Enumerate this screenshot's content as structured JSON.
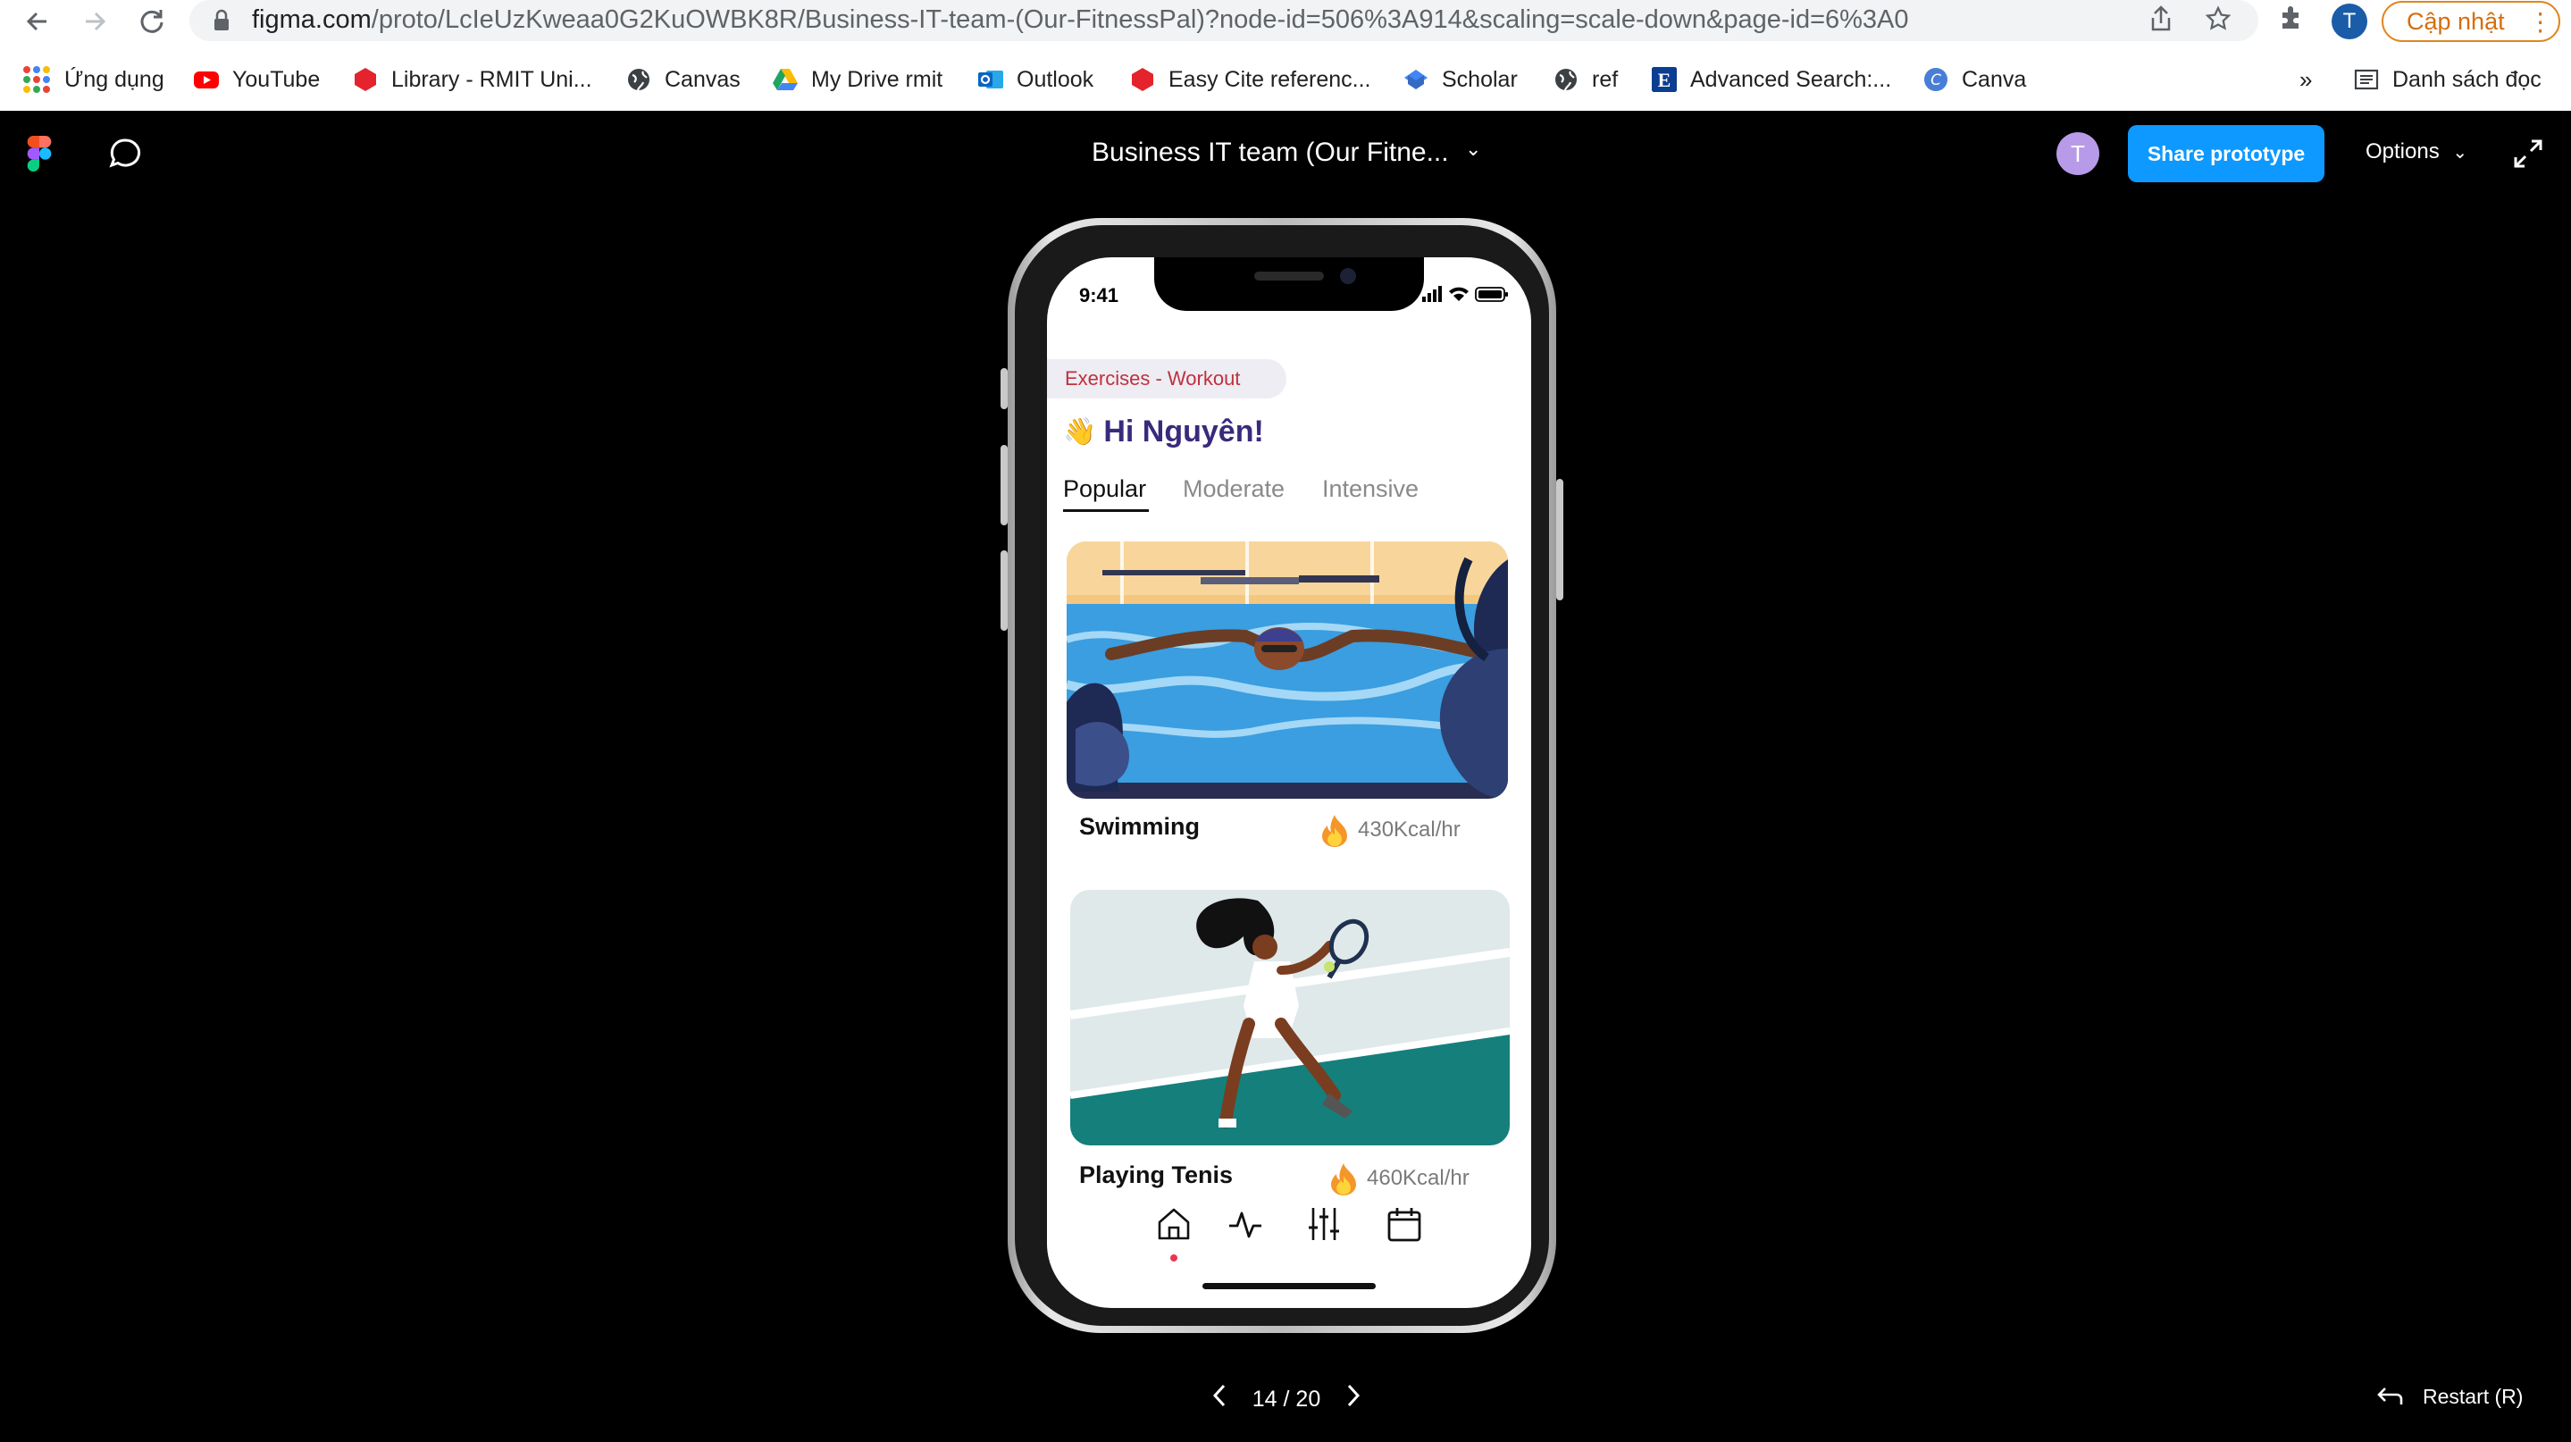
{
  "browser": {
    "url_host": "figma.com",
    "url_path": "/proto/LcIeUzKweaa0G2KuOWBK8R/Business-IT-team-(Our-FitnessPal)?node-id=506%3A914&scaling=scale-down&page-id=6%3A0",
    "profile_initial": "T",
    "update_label": "Cập nhật",
    "bookmarks": [
      {
        "label": "Ứng dụng"
      },
      {
        "label": "YouTube",
        "color": "#ff0000"
      },
      {
        "label": "Library - RMIT Uni...",
        "color": "#e4232c"
      },
      {
        "label": "Canvas",
        "color": "#3c4043"
      },
      {
        "label": "My Drive rmit",
        "color": "#1fa463"
      },
      {
        "label": "Outlook",
        "color": "#0a64c2"
      },
      {
        "label": "Easy Cite referenc...",
        "color": "#e4232c"
      },
      {
        "label": "Scholar",
        "color": "#4285f4"
      },
      {
        "label": "ref",
        "color": "#3c4043"
      },
      {
        "label": "Advanced Search:...",
        "color": "#0b3d91"
      },
      {
        "label": "Canva",
        "color": "#20c4cb"
      }
    ],
    "more_bookmarks": "»",
    "reading_list": "Danh sách đọc"
  },
  "figma": {
    "title": "Business IT team (Our Fitne...",
    "avatar_initial": "T",
    "share_label": "Share prototype",
    "options_label": "Options",
    "page_indicator": "14 / 20",
    "restart_label": "Restart (R)",
    "accent": "#0d99ff"
  },
  "app": {
    "status_time": "9:41",
    "section_chip": "Exercises - Workout",
    "greeting": "Hi Nguyên!",
    "tabs": [
      {
        "label": "Popular"
      },
      {
        "label": "Moderate"
      },
      {
        "label": "Intensive"
      }
    ],
    "cards": [
      {
        "title": "Swimming",
        "kcal": "430Kcal/hr",
        "image": "swimming-illustration"
      },
      {
        "title": "Playing Tenis",
        "kcal": "460Kcal/hr",
        "image": "tennis-illustration"
      }
    ],
    "bottom_nav": [
      "home-icon",
      "activity-icon",
      "sliders-icon",
      "calendar-icon"
    ],
    "colors": {
      "greeting": "#3a2a7c",
      "chip_text": "#c0303e",
      "active_dot": "#e8374f"
    }
  }
}
